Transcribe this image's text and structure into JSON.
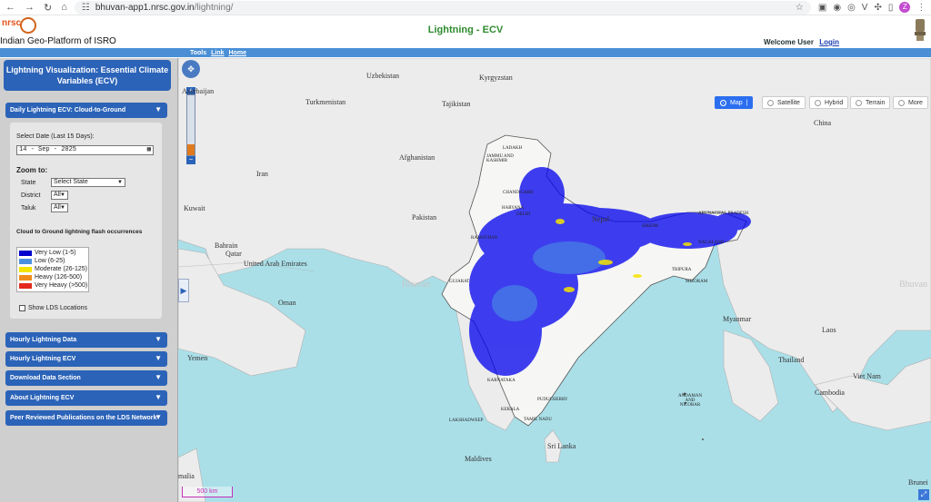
{
  "browser": {
    "url_host": "bhuvan-app1.nrsc.gov.in",
    "url_path": "/lightning/",
    "profile_initial": "Z"
  },
  "header": {
    "org_text": "Indian Geo-Platform of ISRO",
    "logo_text": "nrsc",
    "title": "Lightning - ECV",
    "welcome": "Welcome User",
    "login": "Login"
  },
  "toolbar": {
    "tools": "Tools",
    "link": "Link",
    "home": "Home"
  },
  "sidebar": {
    "title": "Lightning Visualization: Essential Climate Variables (ECV)",
    "active_section": "Daily Lightning ECV: Cloud-to-Ground",
    "select_date_label": "Select Date (Last 15 Days):",
    "date_value": "14 - Sep - 2025",
    "zoom_to": "Zoom to:",
    "state_label": "State",
    "state_value": "Select State",
    "district_label": "District",
    "district_value": "All",
    "taluk_label": "Taluk",
    "taluk_value": "All",
    "cg_caption": "Cloud to Ground lightning flash occurrences",
    "legend": [
      {
        "label": "Very Low (1-5)",
        "color": "#0000cc"
      },
      {
        "label": "Low  (6-25)",
        "color": "#4a90e2"
      },
      {
        "label": "Moderate (26-125)",
        "color": "#f5e400"
      },
      {
        "label": "Heavy (126-500)",
        "color": "#f08c1a"
      },
      {
        "label": "Very Heavy (>500)",
        "color": "#e32a1c"
      }
    ],
    "show_lds": "Show LDS Locations",
    "sections": [
      "Hourly Lightning Data",
      "Hourly Lightning ECV",
      "Download Data Section",
      "About Lightning ECV",
      "Peer Reviewed Publications on the LDS Network"
    ]
  },
  "map": {
    "types": [
      "Map",
      "Satellite",
      "Hybrid",
      "Terrain",
      "More"
    ],
    "active_type": "Map",
    "scale": "500 km",
    "countries": {
      "uzbekistan": "Uzbekistan",
      "kyrgyzstan": "Kyrgyzstan",
      "azerbaijan": "Azerbaijan",
      "turkmenistan": "Turkmenistan",
      "tajikistan": "Tajikistan",
      "china": "China",
      "iran": "Iran",
      "afghanistan": "Afghanistan",
      "kuwait": "Kuwait",
      "pakistan": "Pakistan",
      "nepal": "Nepal",
      "bahrain": "Bahrain",
      "qatar": "Qatar",
      "uae": "United Arab Emirates",
      "oman": "Oman",
      "myanmar": "Myanmar",
      "laos": "Laos",
      "thailand": "Thailand",
      "vietnam": "Viet Nam",
      "cambodia": "Cambodia",
      "yemen": "Yemen",
      "srilanka": "Sri Lanka",
      "maldives": "Maldives",
      "somalia": "malia",
      "brunei": "Brunei"
    },
    "states": {
      "ladakh": "LADAKH",
      "jk": "JAMMU AND KASHMIR",
      "chandigarh": "CHANDIGARH",
      "haryana": "HARYANA",
      "delhi": "DELHI",
      "rajasthan": "RAJASTHAN",
      "gujarat": "GUJARAT",
      "arunachal": "ARUNACHAL PRADESH",
      "sikkim": "SIKKIM",
      "nagaland": "NAGALAND",
      "tripura": "TRIPURA",
      "mizoram": "MIZORAM",
      "karnataka": "KARNATAKA",
      "puducherry": "PUDUCHERRY",
      "kerala": "KERALA",
      "tamilnadu": "TAMIL NADU",
      "lakshadweep": "LAKSHADWEEP",
      "andaman": "ANDAMAN AND NICOBAR"
    },
    "watermark": "Bhuvan"
  }
}
